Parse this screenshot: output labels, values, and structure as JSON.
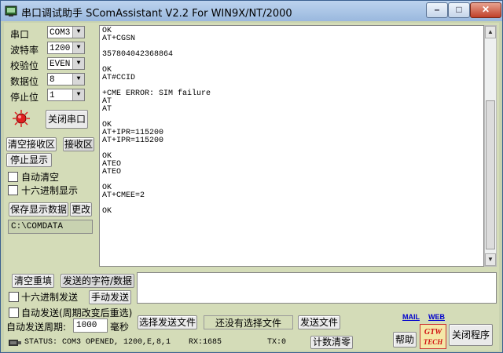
{
  "window": {
    "title": "串口调试助手 SComAssistant V2.2 For WIN9X/NT/2000",
    "minimize": "–",
    "maximize": "□",
    "close": "✕"
  },
  "settings": {
    "port_label": "串口",
    "port_value": "COM3",
    "baud_label": "波特率",
    "baud_value": "1200",
    "parity_label": "校验位",
    "parity_value": "EVEN",
    "databits_label": "数据位",
    "databits_value": "8",
    "stopbits_label": "停止位",
    "stopbits_value": "1",
    "close_port_button": "关闭串口"
  },
  "receive_controls": {
    "clear_button": "清空接收区",
    "receive_label": "接收区",
    "stop_display_button": "停止显示",
    "auto_clear_label": "自动清空",
    "hex_display_label": "十六进制显示",
    "save_button": "保存显示数据",
    "change_button": "更改",
    "path_value": "C:\\COMDATA"
  },
  "receive_area": {
    "text": "OK\nAT+CGSN\n\n357804042368864\n\nOK\nAT#CCID\n\n+CME ERROR: SIM failure\nAT\nAT\n\nOK\nAT+IPR=115200\nAT+IPR=115200\n\nOK\nATEO\nATEO\n\nOK\nAT+CMEE=2\n\nOK"
  },
  "send_controls": {
    "clear_resend_button": "清空重填",
    "send_label": "发送的字符/数据",
    "hex_send_label": "十六进制发送",
    "manual_send_button": "手动发送",
    "auto_send_label": "自动发送(周期改变后重选)",
    "period_label": "自动发送周期:",
    "period_value": "1000",
    "period_unit": "毫秒",
    "select_file_button": "选择发送文件",
    "file_status": "还没有选择文件",
    "send_file_button": "发送文件"
  },
  "status_bar": {
    "status_text": "STATUS: COM3 OPENED, 1200,E,8,1",
    "rx_text": "RX:1685",
    "tx_text": "TX:0",
    "reset_count_button": "计数清零"
  },
  "footer": {
    "mail_link": "MAIL",
    "web_link": "WEB",
    "help_button": "帮助",
    "logo_text": "GTW TECH",
    "exit_button": "关闭程序"
  },
  "colors": {
    "indicator_led": "#e02020",
    "window_bg": "#d4dcb8"
  }
}
